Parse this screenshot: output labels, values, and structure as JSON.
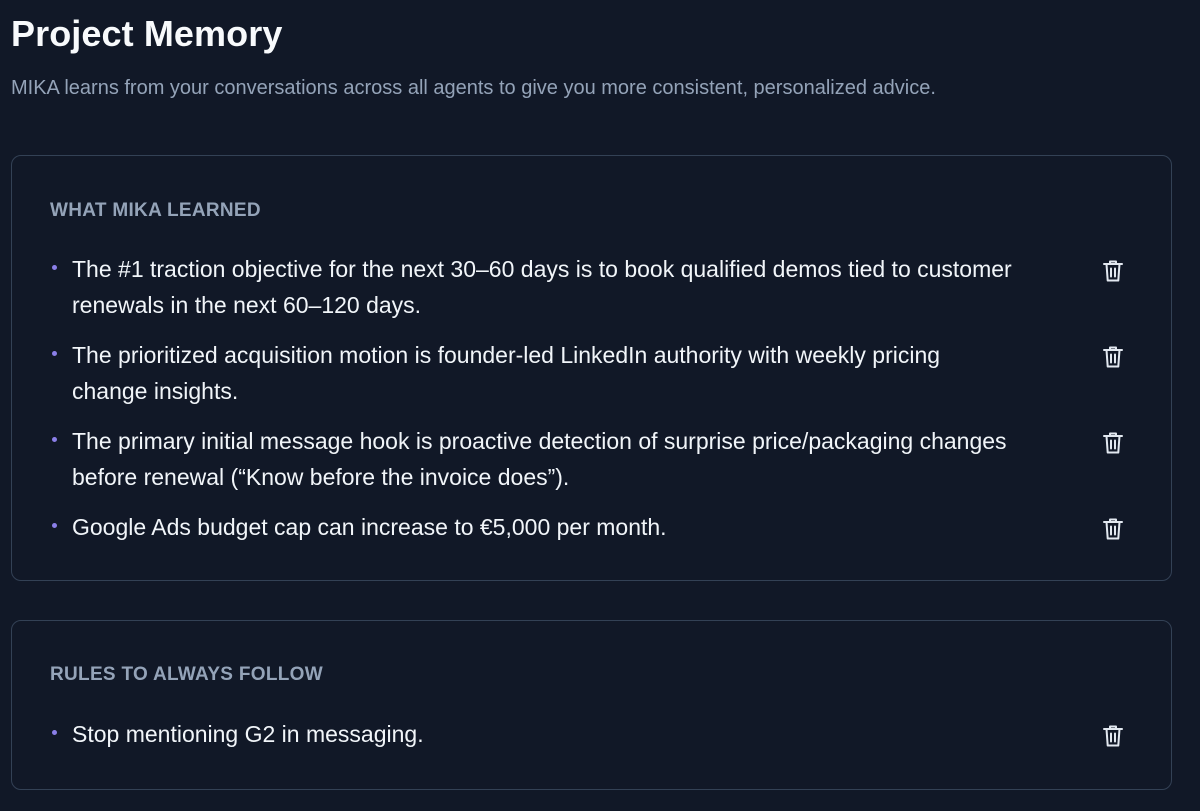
{
  "header": {
    "title": "Project Memory",
    "subtitle": "MIKA learns from your conversations across all agents to give you more consistent, personalized advice."
  },
  "learned": {
    "heading": "WHAT MIKA LEARNED",
    "items": [
      {
        "text": "The #1 traction objective for the next 30–60 days is to book qualified demos tied to customer renewals in the next 60–120 days."
      },
      {
        "text": "The prioritized acquisition motion is founder-led LinkedIn authority with weekly pricing change insights."
      },
      {
        "text": "The primary initial message hook is proactive detection of surprise price/packaging changes before renewal (“Know before the invoice does”)."
      },
      {
        "text": "Google Ads budget cap can increase to €5,000 per month."
      }
    ]
  },
  "rules": {
    "heading": "RULES TO ALWAYS FOLLOW",
    "items": [
      {
        "text": "Stop mentioning G2 in messaging."
      }
    ]
  },
  "icons": {
    "delete": "trash-icon",
    "bullet": "bullet-dot"
  },
  "colors": {
    "background": "#111827",
    "card_border": "#334155",
    "heading": "#94a3b8",
    "text": "#f1f5f9",
    "bullet": "#8b7fe8"
  }
}
